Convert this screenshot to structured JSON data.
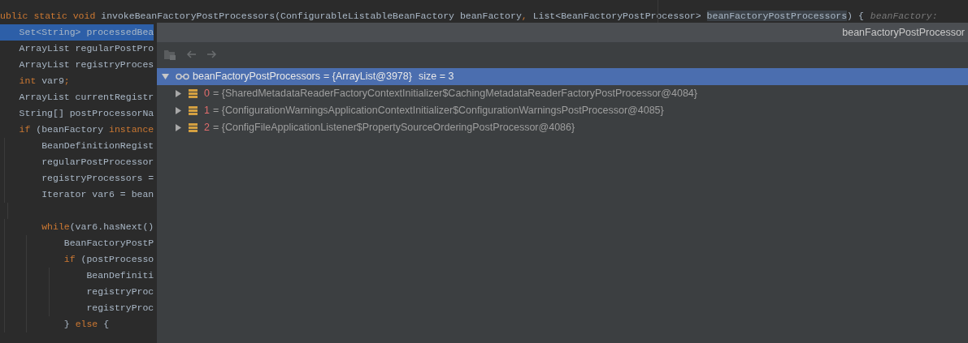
{
  "editor": {
    "lines": [
      {
        "selected": false,
        "tokens": [
          {
            "kind": "keyword",
            "text": "ublic static void "
          },
          {
            "kind": "plain",
            "text": "invokeBeanFactoryPostProcessors(ConfigurableListableBeanFactory beanFactory"
          },
          {
            "kind": "keyword",
            "text": ", "
          },
          {
            "kind": "plain",
            "text": "List<BeanFactoryPostProcessor> "
          },
          {
            "kind": "highlight",
            "text": "beanFactoryPostProcessors"
          },
          {
            "kind": "plain",
            "text": ") {"
          },
          {
            "kind": "hint",
            "text": "beanFactory:"
          }
        ]
      },
      {
        "selected": true,
        "tokens": [
          {
            "kind": "plain",
            "text": "    Set<String> processedBea"
          }
        ]
      },
      {
        "selected": false,
        "tokens": [
          {
            "kind": "plain",
            "text": "    ArrayList regularPostPro"
          }
        ]
      },
      {
        "selected": false,
        "tokens": [
          {
            "kind": "plain",
            "text": "    ArrayList registryProces"
          }
        ]
      },
      {
        "selected": false,
        "tokens": [
          {
            "kind": "keyword",
            "text": "    int "
          },
          {
            "kind": "plain",
            "text": "var9"
          },
          {
            "kind": "keyword",
            "text": ";"
          }
        ]
      },
      {
        "selected": false,
        "tokens": [
          {
            "kind": "plain",
            "text": "    ArrayList currentRegistr"
          }
        ]
      },
      {
        "selected": false,
        "tokens": [
          {
            "kind": "plain",
            "text": "    String[] postProcessorNa"
          }
        ]
      },
      {
        "selected": false,
        "tokens": [
          {
            "kind": "keyword",
            "text": "    if "
          },
          {
            "kind": "plain",
            "text": "(beanFactory "
          },
          {
            "kind": "keyword",
            "text": "instance"
          }
        ]
      },
      {
        "selected": false,
        "tokens": [
          {
            "kind": "plain",
            "text": "        BeanDefinitionRegist"
          }
        ]
      },
      {
        "selected": false,
        "tokens": [
          {
            "kind": "plain",
            "text": "        regularPostProcessor"
          }
        ]
      },
      {
        "selected": false,
        "tokens": [
          {
            "kind": "plain",
            "text": "        registryProcessors ="
          }
        ]
      },
      {
        "selected": false,
        "tokens": [
          {
            "kind": "plain",
            "text": "        Iterator var6 = bean"
          }
        ]
      },
      {
        "selected": false,
        "blank_before": true,
        "tokens": [
          {
            "kind": "keyword",
            "text": "        while"
          },
          {
            "kind": "plain",
            "text": "(var6.hasNext()"
          }
        ]
      },
      {
        "selected": false,
        "tokens": [
          {
            "kind": "plain",
            "text": "            BeanFactoryPostP"
          }
        ]
      },
      {
        "selected": false,
        "tokens": [
          {
            "kind": "keyword",
            "text": "            if "
          },
          {
            "kind": "plain",
            "text": "(postProcesso"
          }
        ]
      },
      {
        "selected": false,
        "tokens": [
          {
            "kind": "plain",
            "text": "                BeanDefiniti"
          }
        ]
      },
      {
        "selected": false,
        "tokens": [
          {
            "kind": "plain",
            "text": "                registryProc"
          }
        ]
      },
      {
        "selected": false,
        "tokens": [
          {
            "kind": "plain",
            "text": "                registryProc"
          }
        ]
      },
      {
        "selected": false,
        "tokens": [
          {
            "kind": "plain",
            "text": "            } "
          },
          {
            "kind": "keyword",
            "text": "else "
          },
          {
            "kind": "plain",
            "text": "{"
          }
        ]
      }
    ]
  },
  "popup": {
    "title": "beanFactoryPostProcessor",
    "tree": {
      "name": "beanFactoryPostProcessors",
      "value": "= {ArrayList@3978}",
      "extra": "size = 3",
      "expanded": true,
      "selected": true,
      "children": [
        {
          "name": "0",
          "value": "= {SharedMetadataReaderFactoryContextInitializer$CachingMetadataReaderFactoryPostProcessor@4084}",
          "expanded": false,
          "selected": false
        },
        {
          "name": "1",
          "value": "= {ConfigurationWarningsApplicationContextInitializer$ConfigurationWarningsPostProcessor@4085}",
          "expanded": false,
          "selected": false
        },
        {
          "name": "2",
          "value": "= {ConfigFileApplicationListener$PropertySourceOrderingPostProcessor@4086}",
          "expanded": false,
          "selected": false
        }
      ]
    }
  }
}
